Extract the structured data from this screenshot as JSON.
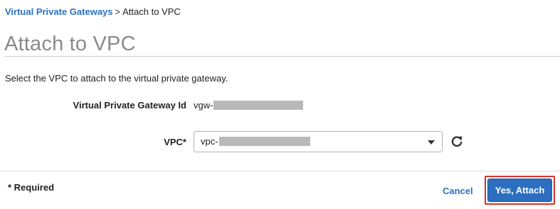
{
  "breadcrumb": {
    "parent_label": "Virtual Private Gateways",
    "separator": ">",
    "current_label": "Attach to VPC"
  },
  "page": {
    "title": "Attach to VPC",
    "description": "Select the VPC to attach to the virtual private gateway."
  },
  "form": {
    "vgw_label": "Virtual Private Gateway Id",
    "vgw_value_prefix": "vgw-",
    "vpc_label": "VPC*",
    "vpc_value_prefix": "vpc-",
    "refresh_icon": "refresh-icon"
  },
  "footer": {
    "required_note": "* Required",
    "cancel_label": "Cancel",
    "attach_label": "Yes, Attach"
  },
  "colors": {
    "link": "#2a72c1",
    "primary_button": "#2c6fc0",
    "highlight_border": "#d9332b",
    "title_gray": "#8a8a8a"
  }
}
